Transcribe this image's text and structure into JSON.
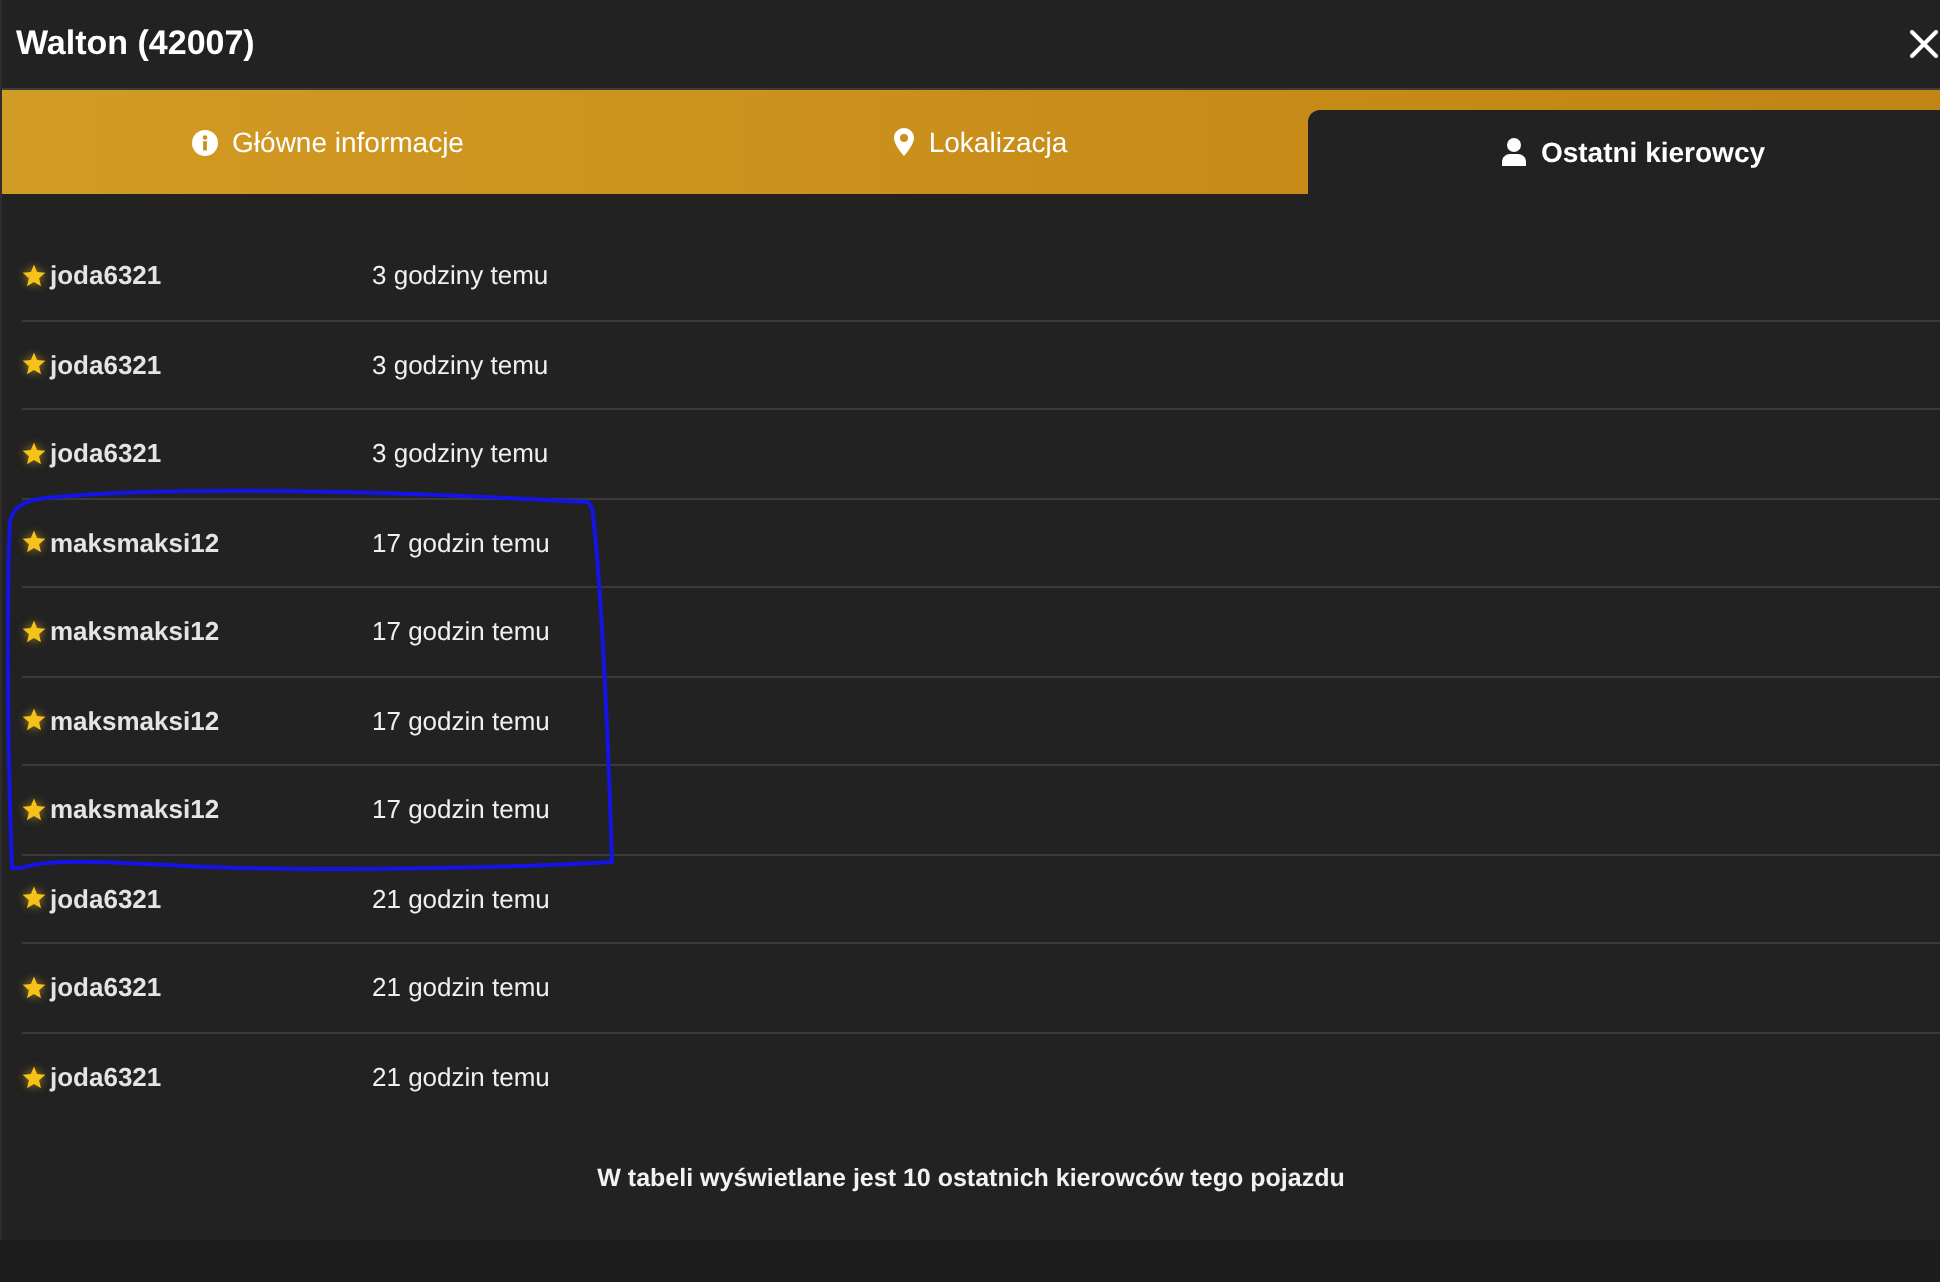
{
  "window": {
    "title": "Walton (42007)"
  },
  "tabs": [
    {
      "label": "Główne informacje",
      "selected": false
    },
    {
      "label": "Lokalizacja",
      "selected": false
    },
    {
      "label": "Ostatni kierowcy",
      "selected": true
    }
  ],
  "drivers": [
    {
      "name": "joda6321",
      "time": "3 godziny temu"
    },
    {
      "name": "joda6321",
      "time": "3 godziny temu"
    },
    {
      "name": "joda6321",
      "time": "3 godziny temu"
    },
    {
      "name": "maksmaksi12",
      "time": "17 godzin temu"
    },
    {
      "name": "maksmaksi12",
      "time": "17 godzin temu"
    },
    {
      "name": "maksmaksi12",
      "time": "17 godzin temu"
    },
    {
      "name": "maksmaksi12",
      "time": "17 godzin temu"
    },
    {
      "name": "joda6321",
      "time": "21 godzin temu"
    },
    {
      "name": "joda6321",
      "time": "21 godzin temu"
    },
    {
      "name": "joda6321",
      "time": "21 godzin temu"
    }
  ],
  "footer_note": "W tabeli wyświetlane jest 10 ostatnich kierowców tego pojazdu"
}
